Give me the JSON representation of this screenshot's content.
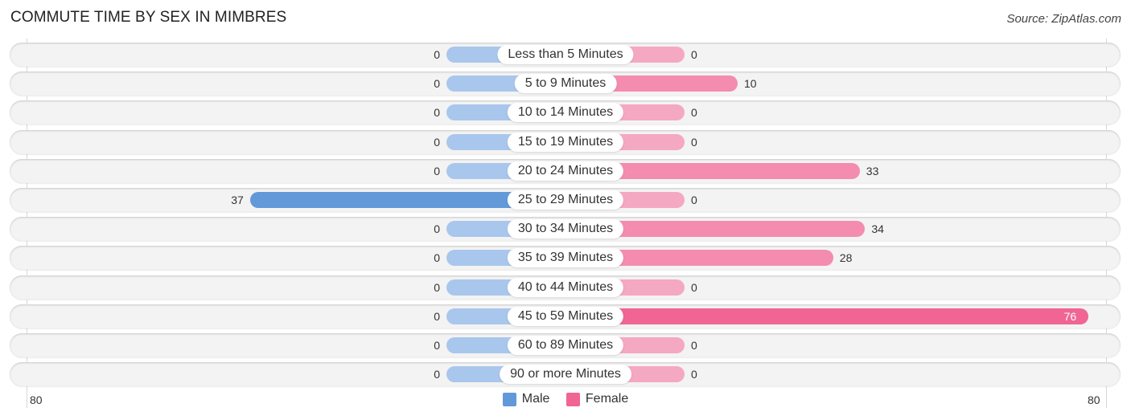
{
  "chart_data": {
    "type": "bar",
    "orientation": "horizontal-diverging",
    "title": "COMMUTE TIME BY SEX IN MIMBRES",
    "source": "Source: ZipAtlas.com",
    "categories": [
      "Less than 5 Minutes",
      "5 to 9 Minutes",
      "10 to 14 Minutes",
      "15 to 19 Minutes",
      "20 to 24 Minutes",
      "25 to 29 Minutes",
      "30 to 34 Minutes",
      "35 to 39 Minutes",
      "40 to 44 Minutes",
      "45 to 59 Minutes",
      "60 to 89 Minutes",
      "90 or more Minutes"
    ],
    "series": [
      {
        "name": "Male",
        "color": "#6399d9",
        "values": [
          0,
          0,
          0,
          0,
          0,
          37,
          0,
          0,
          0,
          0,
          0,
          0
        ]
      },
      {
        "name": "Female",
        "color": "#f06593",
        "values": [
          0,
          10,
          0,
          0,
          33,
          0,
          34,
          28,
          0,
          76,
          0,
          0
        ]
      }
    ],
    "axis": {
      "left_tick": "80",
      "right_tick": "80",
      "range": [
        -80,
        80
      ]
    },
    "legend": {
      "position": "bottom-center",
      "items": [
        "Male",
        "Female"
      ]
    }
  }
}
